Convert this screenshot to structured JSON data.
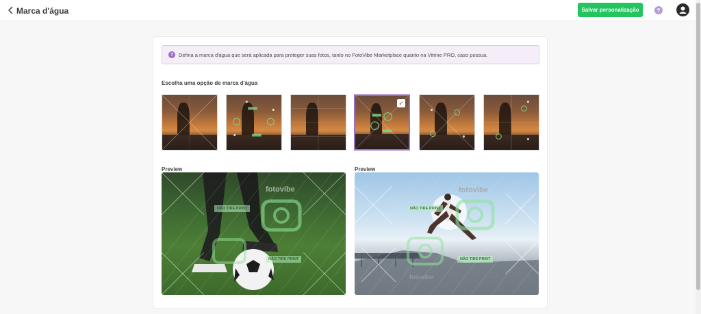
{
  "header": {
    "title": "Marca d'água",
    "save_label": "Salvar personalização",
    "help_glyph": "?"
  },
  "info": {
    "glyph": "?",
    "text": "Defina a marca d'água que será aplicada para proteger suas fotos, tanto no FotoVibe Marketplace quanto na Vitrine PRO, caso possua."
  },
  "options": {
    "label": "Escolha uma opção de marca d'água",
    "selected_index": 3,
    "check_glyph": "✓"
  },
  "preview": {
    "label_1": "Preview",
    "label_2": "Preview",
    "brand": "fotovibe",
    "stamp": "NÃO TIRE PRINT"
  },
  "colors": {
    "accent_green": "#22c55e",
    "accent_purple": "#9b6dc6"
  }
}
